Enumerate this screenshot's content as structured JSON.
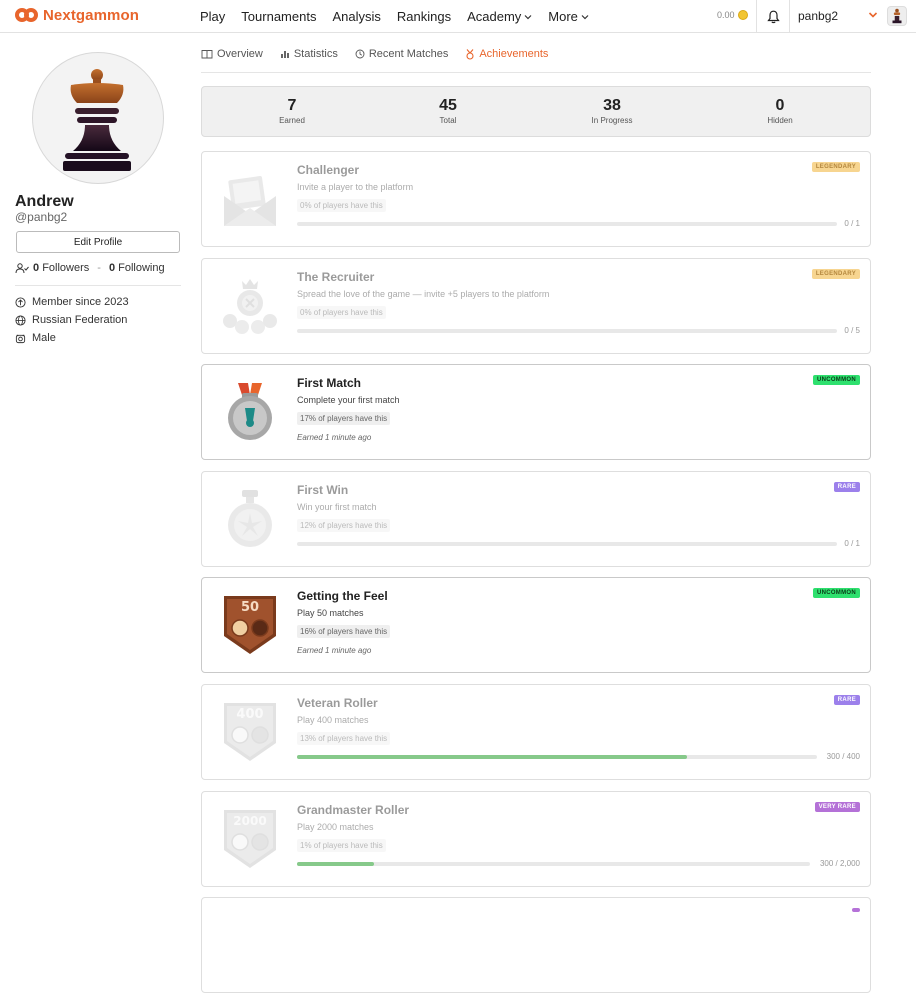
{
  "brand": {
    "name": "Nextgammon",
    "color": "#e8652c"
  },
  "nav": {
    "items": [
      {
        "label": "Play",
        "has_menu": false
      },
      {
        "label": "Tournaments",
        "has_menu": false
      },
      {
        "label": "Analysis",
        "has_menu": false
      },
      {
        "label": "Rankings",
        "has_menu": false
      },
      {
        "label": "Academy",
        "has_menu": true
      },
      {
        "label": "More",
        "has_menu": true
      }
    ],
    "balance": "0.00",
    "username": "panbg2",
    "icons": {
      "bell": "bell-icon",
      "coin": "coin-icon",
      "chevron": "chevron-down-icon"
    }
  },
  "profile": {
    "display_name": "Andrew",
    "handle": "@panbg2",
    "edit_label": "Edit Profile",
    "followers_count": "0",
    "followers_label": "Followers",
    "following_count": "0",
    "following_label": "Following",
    "member_since": "Member since 2023",
    "country": "Russian Federation",
    "gender": "Male"
  },
  "tabs": [
    {
      "label": "Overview",
      "icon": "book-icon",
      "active": false
    },
    {
      "label": "Statistics",
      "icon": "bar-chart-icon",
      "active": false
    },
    {
      "label": "Recent Matches",
      "icon": "history-icon",
      "active": false
    },
    {
      "label": "Achievements",
      "icon": "medal-icon",
      "active": true
    }
  ],
  "summary": [
    {
      "value": "7",
      "label": "Earned"
    },
    {
      "value": "45",
      "label": "Total"
    },
    {
      "value": "38",
      "label": "In Progress"
    },
    {
      "value": "0",
      "label": "Hidden"
    }
  ],
  "achievements": [
    {
      "title": "Challenger",
      "description": "Invite a player to the platform",
      "players_pct": "0% of players have this",
      "rarity": "LEGENDARY",
      "earned": false,
      "progress": 0,
      "progress_label": "0 / 1",
      "icon": "envelope-icon"
    },
    {
      "title": "The Recruiter",
      "description": "Spread the love of the game — invite +5 players to the platform",
      "players_pct": "0% of players have this",
      "rarity": "LEGENDARY",
      "earned": false,
      "progress": 0,
      "progress_label": "0 / 5",
      "icon": "recruiter-icon"
    },
    {
      "title": "First Match",
      "description": "Complete your first match",
      "players_pct": "17% of players have this",
      "rarity": "UNCOMMON",
      "earned": true,
      "earned_text": "Earned 1 minute ago",
      "icon": "medal-icon"
    },
    {
      "title": "First Win",
      "description": "Win your first match",
      "players_pct": "12% of players have this",
      "rarity": "RARE",
      "earned": false,
      "progress": 0,
      "progress_label": "0 / 1",
      "icon": "star-medal-icon"
    },
    {
      "title": "Getting the Feel",
      "description": "Play 50 matches",
      "players_pct": "16% of players have this",
      "rarity": "UNCOMMON",
      "earned": true,
      "earned_text": "Earned 1 minute ago",
      "icon": "shield-50-icon",
      "shield_number": "50"
    },
    {
      "title": "Veteran Roller",
      "description": "Play 400 matches",
      "players_pct": "13% of players have this",
      "rarity": "RARE",
      "earned": false,
      "progress": 0.75,
      "progress_label": "300 / 400",
      "icon": "shield-400-icon",
      "shield_number": "400"
    },
    {
      "title": "Grandmaster Roller",
      "description": "Play 2000 matches",
      "players_pct": "1% of players have this",
      "rarity": "VERY RARE",
      "earned": false,
      "progress": 0.15,
      "progress_label": "300 / 2,000",
      "icon": "shield-2000-icon",
      "shield_number": "2000"
    }
  ],
  "colors": {
    "legendary": "#f6ce7d",
    "uncommon": "#2ee06e",
    "rare": "#8b6ae8",
    "very_rare": "#a859d1",
    "progress": "#86c98a"
  }
}
